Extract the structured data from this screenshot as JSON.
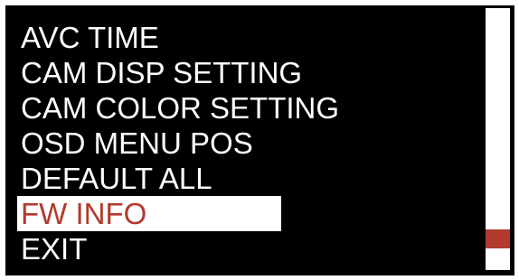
{
  "menu": {
    "items": [
      {
        "label": "AVC TIME"
      },
      {
        "label": "CAM DISP SETTING"
      },
      {
        "label": "CAM COLOR SETTING"
      },
      {
        "label": "OSD MENU POS"
      },
      {
        "label": "DEFAULT ALL"
      },
      {
        "label": "FW INFO",
        "selected": true
      },
      {
        "label": "EXIT"
      }
    ],
    "selected_index": 5
  },
  "scrollbar": {
    "position_fraction": 0.88
  },
  "colors": {
    "background": "#000000",
    "text": "#ffffff",
    "highlight_bg": "#ffffff",
    "highlight_text": "#b23a2e",
    "scroll_thumb": "#b23a2e",
    "scroll_track": "#ffffff"
  }
}
